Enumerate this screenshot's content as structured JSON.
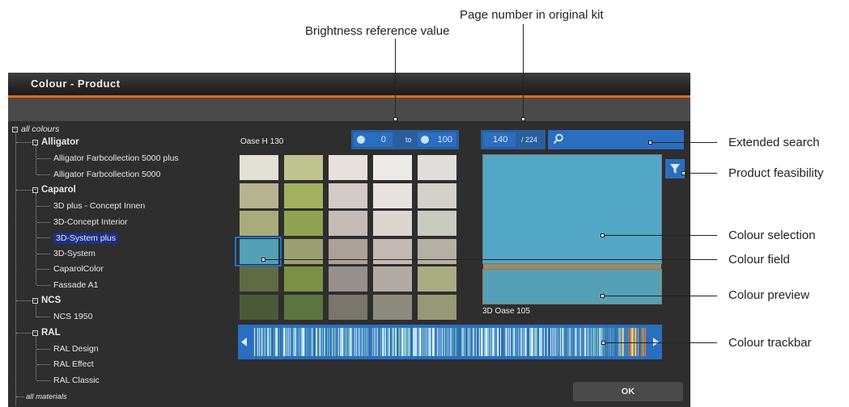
{
  "window": {
    "title": "Colour - Product"
  },
  "tree": {
    "root": "all colours",
    "groups": [
      {
        "label": "Alligator",
        "items": [
          "Alligator Farbcollection 5000 plus",
          "Alligator Farbcollection 5000"
        ]
      },
      {
        "label": "Caparol",
        "items": [
          "3D plus - Concept Innen",
          "3D-Concept Interior",
          "3D-System plus",
          "3D-System",
          "CaparolColor",
          "Fassade A1"
        ]
      },
      {
        "label": "NCS",
        "items": [
          "NCS 1950"
        ]
      },
      {
        "label": "RAL",
        "items": [
          "RAL Design",
          "RAL Effect",
          "RAL Classic"
        ]
      }
    ],
    "footer": "all materials",
    "selected": "3D-System plus"
  },
  "colour_area": {
    "current_name": "Oase H 130",
    "brightness": {
      "from": "0",
      "to_label": "to",
      "to": "100"
    },
    "page": {
      "current": "140",
      "total": "/ 224"
    },
    "preview_name": "3D Oase 105",
    "selection_color": "#53a7c6",
    "preview_color": "#55a0b6",
    "ok_label": "OK"
  },
  "swatches": [
    [
      "#e3e0d5",
      "#bfc38e",
      "#e7e1dc",
      "#ecebe7",
      "#dfdedb"
    ],
    [
      "#b7b290",
      "#a2b05f",
      "#d2cbc6",
      "#e7e4e0",
      "#d3d1c9"
    ],
    [
      "#a9ac7a",
      "#90a24f",
      "#c6bcb7",
      "#dcd6d0",
      "#c8ccbf"
    ],
    [
      "#54a0b6",
      "#9aa070",
      "#aba198",
      "#c4bab3",
      "#b4b1a4"
    ],
    [
      "#5e6b43",
      "#7b9145",
      "#97908a",
      "#b2aba4",
      "#a9ad82"
    ],
    [
      "#4a5a38",
      "#5c7440",
      "#7b766b",
      "#8d8b7d",
      "#959975"
    ]
  ],
  "callouts": {
    "brightness": "Brightness reference value",
    "page": "Page number in original kit",
    "extended_search": "Extended search",
    "feasibility": "Product feasibility",
    "selection": "Colour selection",
    "field": "Colour field",
    "preview": "Colour preview",
    "trackbar": "Colour trackbar"
  },
  "icons": {
    "search": "search-icon",
    "filter": "filter-icon",
    "brightness": "brightness-icon",
    "arrows": [
      "arrow-left-icon",
      "arrow-right-icon"
    ],
    "tree_toggle": "collapse-icon"
  }
}
